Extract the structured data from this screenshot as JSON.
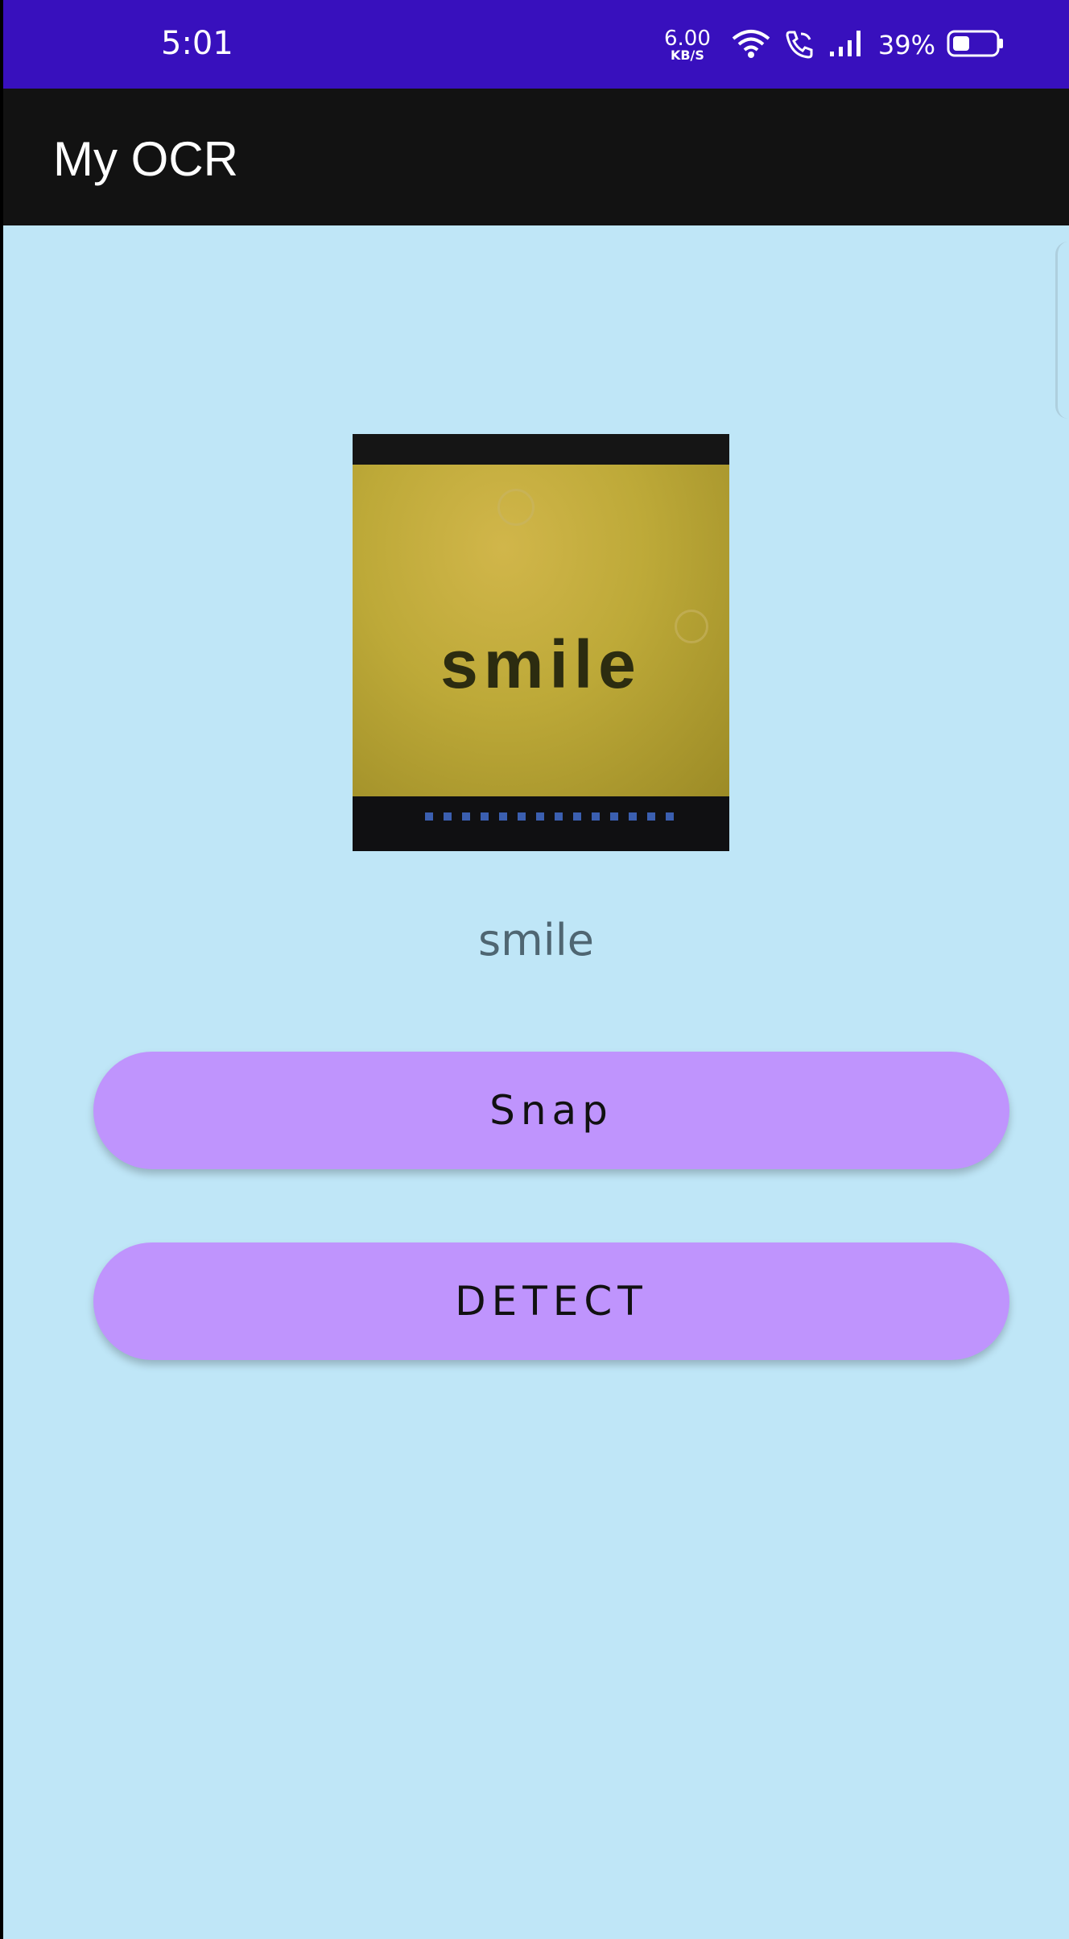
{
  "status_bar": {
    "time": "5:01",
    "net_speed_value": "6.00",
    "net_speed_unit": "KB/S",
    "battery_percent": "39%",
    "battery_level": 0.39,
    "icons": [
      "wifi-icon",
      "wifi-calling-icon",
      "signal-icon",
      "battery-icon"
    ]
  },
  "app_bar": {
    "title": "My OCR"
  },
  "captured_image": {
    "word": "smile"
  },
  "result": {
    "text": "smile"
  },
  "buttons": {
    "snap_label": "Snap",
    "detect_label": "DETECT"
  },
  "colors": {
    "status_bar": "#3810bd",
    "app_bar": "#121212",
    "background": "#bfe6f7",
    "button": "#bf94fd"
  }
}
